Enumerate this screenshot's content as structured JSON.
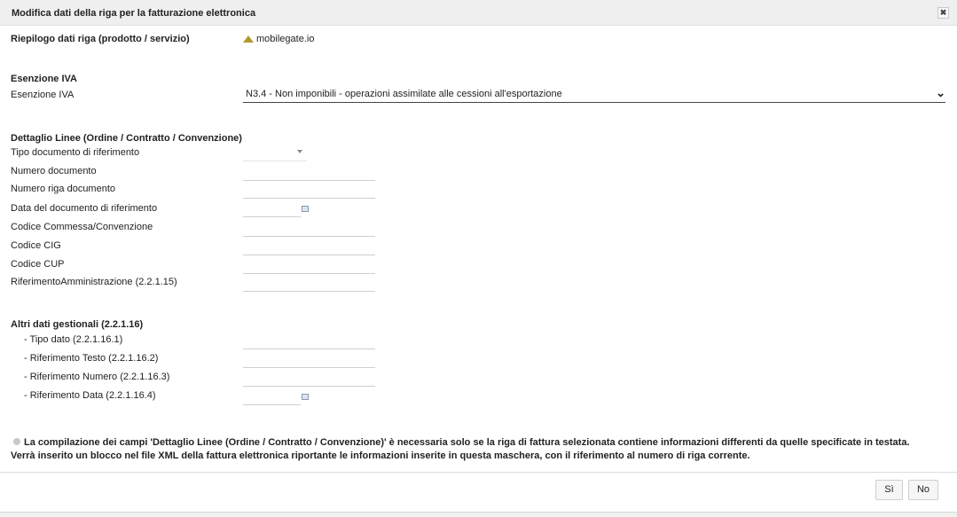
{
  "dialog": {
    "title": "Modifica dati della riga per la fatturazione elettronica",
    "close_glyph": "✖",
    "close_icon": "close-icon"
  },
  "riepilogo": {
    "label": "Riepilogo dati riga (prodotto / servizio)",
    "value": "mobilegate.io",
    "value_icon": "product-icon"
  },
  "esenzione": {
    "section_title": "Esenzione IVA",
    "label": "Esenzione IVA",
    "selected": "N3.4 - Non imponibili - operazioni assimilate alle cessioni all'esportazione",
    "chevron": "⌄"
  },
  "dettaglio": {
    "section_title": "Dettaglio Linee (Ordine / Contratto / Convenzione)",
    "fields": [
      {
        "label": "Tipo documento di riferimento",
        "type": "select",
        "value": ""
      },
      {
        "label": "Numero documento",
        "type": "text",
        "value": ""
      },
      {
        "label": "Numero riga documento",
        "type": "text",
        "value": ""
      },
      {
        "label": "Data del documento di riferimento",
        "type": "date",
        "value": ""
      },
      {
        "label": "Codice Commessa/Convenzione",
        "type": "text",
        "value": ""
      },
      {
        "label": "Codice CIG",
        "type": "text",
        "value": ""
      },
      {
        "label": "Codice CUP",
        "type": "text",
        "value": ""
      },
      {
        "label": "RiferimentoAmministrazione (2.2.1.15)",
        "type": "text",
        "value": ""
      }
    ]
  },
  "altri": {
    "section_title": "Altri dati gestionali (2.2.1.16)",
    "fields": [
      {
        "label": "- Tipo dato (2.2.1.16.1)",
        "type": "text",
        "value": ""
      },
      {
        "label": "- Riferimento Testo (2.2.1.16.2)",
        "type": "text",
        "value": ""
      },
      {
        "label": "- Riferimento Numero (2.2.1.16.3)",
        "type": "text",
        "value": ""
      },
      {
        "label": "- Riferimento Data (2.2.1.16.4)",
        "type": "date",
        "value": ""
      }
    ]
  },
  "note": {
    "icon": "info-icon",
    "line1": "La compilazione dei campi 'Dettaglio Linee (Ordine / Contratto / Convenzione)' è necessaria solo se la riga di fattura selezionata contiene informazioni differenti da quelle specificate in testata.",
    "line2": "Verrà inserito un blocco nel file XML della fattura elettronica riportante le informazioni inserite in questa maschera, con il riferimento al numero di riga corrente."
  },
  "buttons": {
    "yes": "Sì",
    "no": "No"
  },
  "colors": {
    "titlebar_bg": "#efefef",
    "product_icon": "#b29a2c",
    "calendar_icon": "#8a9ab0"
  }
}
